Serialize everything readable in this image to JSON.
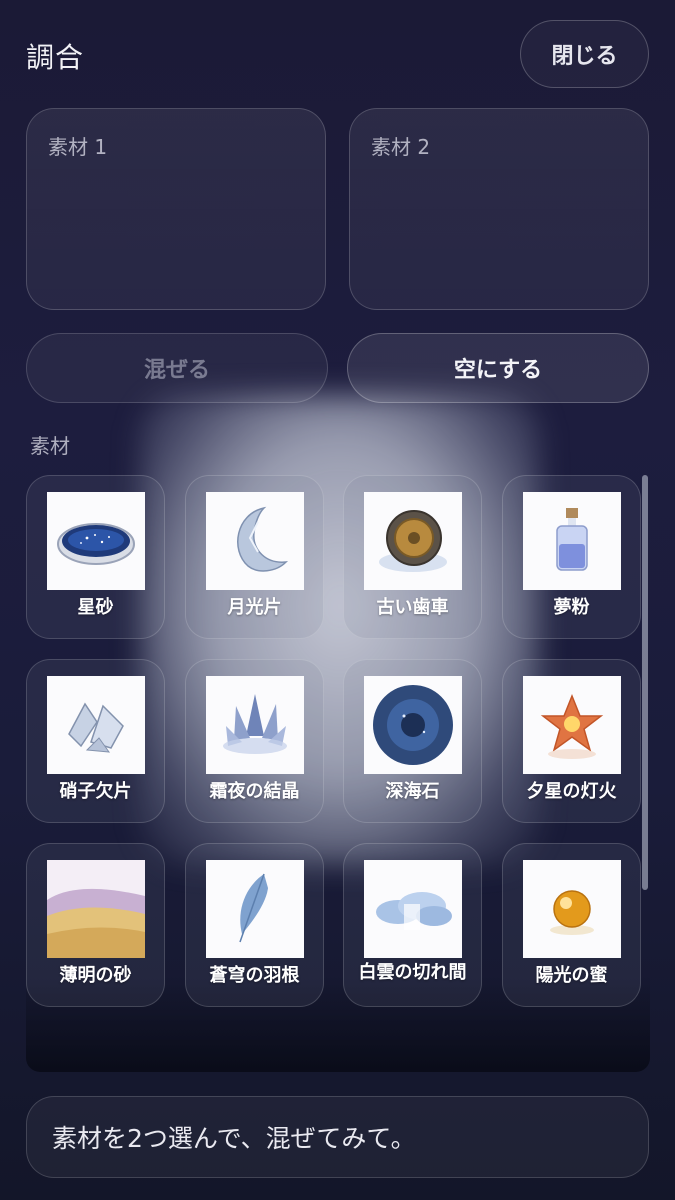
{
  "header": {
    "title": "調合",
    "close_label": "閉じる"
  },
  "slots": [
    {
      "label": "素材 1"
    },
    {
      "label": "素材 2"
    }
  ],
  "actions": {
    "mix_label": "混ぜる",
    "empty_label": "空にする"
  },
  "materials_section": {
    "label": "素材",
    "items": [
      {
        "name": "星砂",
        "icon": "star-sand-icon"
      },
      {
        "name": "月光片",
        "icon": "moonlight-shard-icon"
      },
      {
        "name": "古い歯車",
        "icon": "old-gear-icon"
      },
      {
        "name": "夢粉",
        "icon": "dream-powder-icon"
      },
      {
        "name": "硝子欠片",
        "icon": "glass-shard-icon"
      },
      {
        "name": "霜夜の結晶",
        "icon": "frost-crystal-icon"
      },
      {
        "name": "深海石",
        "icon": "deep-sea-stone-icon"
      },
      {
        "name": "夕星の灯火",
        "icon": "evening-star-flame-icon"
      },
      {
        "name": "薄明の砂",
        "icon": "twilight-sand-icon"
      },
      {
        "name": "蒼穹の羽根",
        "icon": "azure-feather-icon"
      },
      {
        "name": "白雲の切れ間",
        "icon": "cloud-gap-icon"
      },
      {
        "name": "陽光の蜜",
        "icon": "sunlight-honey-icon"
      }
    ]
  },
  "status": {
    "message": "素材を2つ選んで、混ぜてみて。"
  }
}
